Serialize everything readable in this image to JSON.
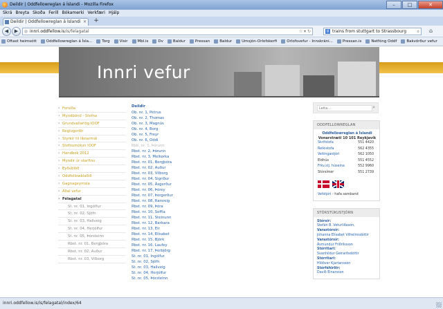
{
  "window": {
    "title": "Deildir | Oddfellowreglan á Íslandi - Mozilla Firefox",
    "min": "–",
    "max": "□",
    "close": "✕"
  },
  "menu": [
    "Skrá",
    "Breyta",
    "Skoða",
    "Ferill",
    "Bókamerki",
    "Verkfæri",
    "Hjálp"
  ],
  "tab": {
    "title": "Deildir | Oddfellowreglan á Íslandi",
    "close": "×",
    "new": "+"
  },
  "nav": {
    "back": "◀",
    "forward": "▶",
    "url_host": "innri.oddfellow.is",
    "url_path": "/is/felagatal",
    "url_icons": "☆ ▾ ↻",
    "search_engine": "g",
    "search_value": "trains from stuttgart to Strassbourg",
    "search_icon": "⌕",
    "home": "⌂"
  },
  "bookmarks": [
    "Oftast heimsótt",
    "Oddfellowreglan á Ísla...",
    "Torg",
    "Visir",
    "Mbl.is",
    "Dv",
    "Baldur",
    "Pressan",
    "Baldur",
    "Umsjón-Orlofskerfi",
    "Orlofsvefur - Innskráni...",
    "Pressan.is",
    "Netfóng Oddf",
    "Bakvörður vefur"
  ],
  "page": {
    "banner_title": "Innri vefur",
    "left_nav": [
      {
        "label": "Forsíða",
        "type": "top"
      },
      {
        "label": "Myndbönd - Stefna",
        "type": "top"
      },
      {
        "label": "Grundvallarlög IOOF",
        "type": "top"
      },
      {
        "label": "Reglugerðir",
        "type": "top"
      },
      {
        "label": "Styrkir til líknarmál",
        "type": "top"
      },
      {
        "label": "Stefnumótun IOOF",
        "type": "top"
      },
      {
        "label": "Handbók 2012",
        "type": "top"
      },
      {
        "label": "Myndir úr starfinu",
        "type": "top"
      },
      {
        "label": "Eyðublöð",
        "type": "top"
      },
      {
        "label": "Oddfellowblaðið",
        "type": "top"
      },
      {
        "label": "Gagnageymsla",
        "type": "top"
      },
      {
        "label": "Aðal vefur",
        "type": "top"
      },
      {
        "label": "Félagatal",
        "type": "active"
      },
      {
        "label": "St. nr. 01, Ingólfur",
        "type": "sub"
      },
      {
        "label": "St. nr. 02, Sjöfn",
        "type": "sub"
      },
      {
        "label": "St. nr. 03, Hallveig",
        "type": "sub"
      },
      {
        "label": "St. nr. 04, Herjólfur",
        "type": "sub"
      },
      {
        "label": "St. nr. 05, Þórsteinn",
        "type": "sub"
      },
      {
        "label": "Rbst. nr. 01, Bergþóra",
        "type": "sub"
      },
      {
        "label": "Rbst. nr. 02, Auður",
        "type": "sub"
      },
      {
        "label": "Rbst. nr. 03, Vilborg",
        "type": "sub"
      }
    ],
    "main_heading": "Deildir",
    "main_links": [
      {
        "label": "Ob. nr. 1, Pétrus"
      },
      {
        "label": "Ob. nr. 2, Thomas"
      },
      {
        "label": "Ob. nr. 3, Magnús"
      },
      {
        "label": "Ob. nr. 4, Borg"
      },
      {
        "label": "Ob. nr. 5, Freyr"
      },
      {
        "label": "Ob. nr. 6, Oddi"
      },
      {
        "label": "Rbb. nr. 1, Þórunn",
        "dim": true
      },
      {
        "label": "Rbst. nr. 2, Þórunn"
      },
      {
        "label": "Rbst. nr. 3, Melkorka"
      },
      {
        "label": "Rbst. nr. 01, Bergþóra"
      },
      {
        "label": "Rbst. nr. 02, Auður"
      },
      {
        "label": "Rbst. nr. 03, Vilborg"
      },
      {
        "label": "Rbst. nr. 04, Sigríður"
      },
      {
        "label": "Rbst. nr. 05, Ásgerður"
      },
      {
        "label": "Rbst. nr. 06, Þórey"
      },
      {
        "label": "Rbst. nr. 07, Þorgerður"
      },
      {
        "label": "Rbst. nr. 08, Ranveig"
      },
      {
        "label": "Rbst. nr. 09, Þóra"
      },
      {
        "label": "Rbst. nr. 10, Soffía"
      },
      {
        "label": "Rbst. nr. 11, Steinunn"
      },
      {
        "label": "Rbst. nr. 12, Barbara"
      },
      {
        "label": "Rbst. nr. 13, Eir"
      },
      {
        "label": "Rbst. nr. 14, Elísabet"
      },
      {
        "label": "Rbst. nr. 15, Björk"
      },
      {
        "label": "Rbst. nr. 16, Laufey"
      },
      {
        "label": "Rbst. nr. 17, Þorbjörg"
      },
      {
        "label": "St. nr. 01, Ingólfur"
      },
      {
        "label": "St. nr. 02, Sjöfn"
      },
      {
        "label": "St. nr. 03, Hallveig"
      },
      {
        "label": "St. nr. 04, Herjólfur"
      },
      {
        "label": "St. nr. 05, Þórsteinn"
      }
    ],
    "search_placeholder": "Leita...",
    "search_icon": "⌕",
    "oddfellow_panel": {
      "title": "ODDFELLOWREGLAN",
      "addr1": "Oddfellowreglan á Íslandi",
      "addr2": "Vonarstræti 10 101 Reykjavík",
      "rows": [
        {
          "label": "Skrifstofa",
          "number": "551 4420",
          "link": true
        },
        {
          "label": "Reikistofa",
          "number": "562 4355",
          "link": true
        },
        {
          "label": "Veitingastjóri",
          "number": "562 1050",
          "link": true
        },
        {
          "label": "Eldhús",
          "number": "551 4552",
          "link": false
        },
        {
          "label": "Frkv.stj. húseina",
          "number": "552 9960",
          "link": true
        },
        {
          "label": "Stórsímer",
          "number": "551 2739",
          "link": false
        }
      ],
      "contact_link": "Vefstjóri",
      "contact_rest": " - hafa samband"
    },
    "lodge_panel": {
      "title": "STÓRSTÚKUSTJÓRN",
      "entries": [
        {
          "text": "Stórsír:",
          "head": true
        },
        {
          "text": "Stefán B. Veturliðason,",
          "head": false
        },
        {
          "text": "Varastórsír:",
          "head": true
        },
        {
          "text": "Jóhanna Elísabet Vilhelmsdóttir",
          "head": false
        },
        {
          "text": "Varastórsír:",
          "head": true
        },
        {
          "text": "Ásmundur Friðriksson",
          "head": false
        },
        {
          "text": "Stórritari:",
          "head": true
        },
        {
          "text": "Svanhildur Geirarðsdóttir",
          "head": false
        },
        {
          "text": "Stórritari:",
          "head": true
        },
        {
          "text": "Hlöðver Kjartansson",
          "head": false
        },
        {
          "text": "Stórféhirðir:",
          "head": true
        },
        {
          "text": "Davíð Einarsson",
          "head": false
        }
      ]
    }
  },
  "status": "innri.oddfellow.is/is/felagatal/index/64"
}
